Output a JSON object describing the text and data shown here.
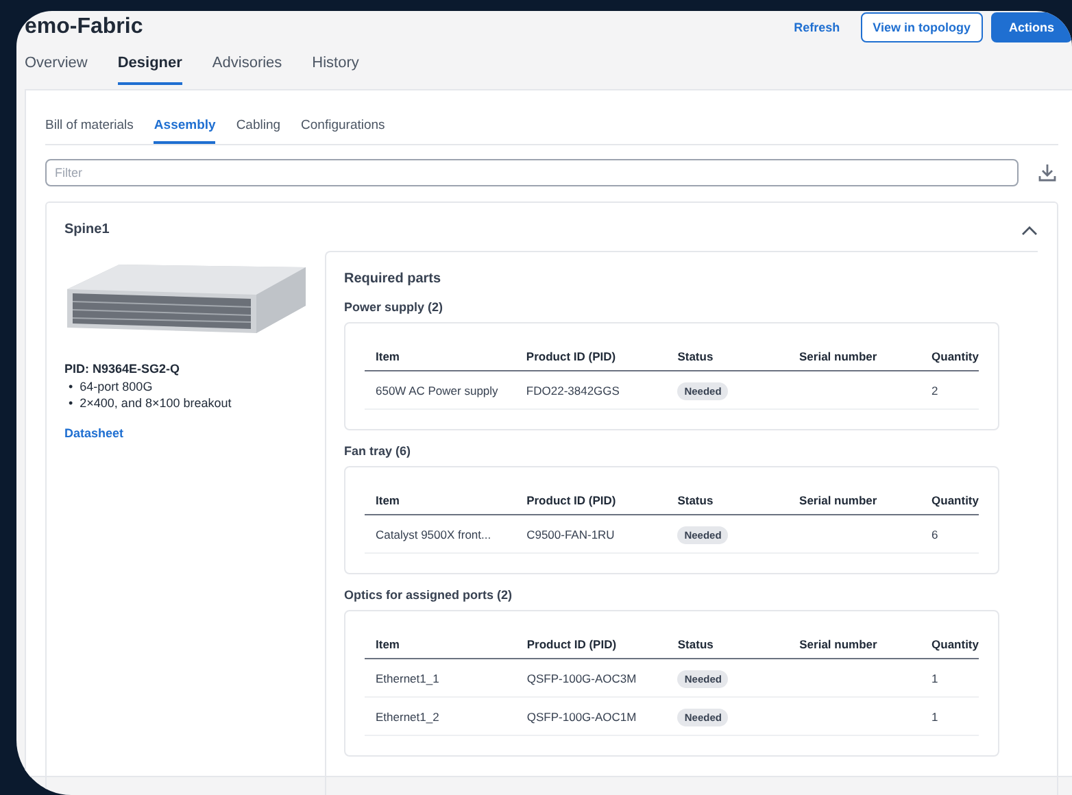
{
  "header": {
    "title": "emo-Fabric",
    "actions": [
      {
        "label": "Refresh",
        "kind": "link"
      },
      {
        "label": "View in topology",
        "kind": "outline"
      },
      {
        "label": "Actions",
        "kind": "primary"
      }
    ]
  },
  "tabs": [
    {
      "label": "Overview",
      "selected": false
    },
    {
      "label": "Designer",
      "selected": true
    },
    {
      "label": "Advisories",
      "selected": false
    },
    {
      "label": "History",
      "selected": false
    }
  ],
  "subtabs": [
    {
      "label": "Bill of materials",
      "selected": false
    },
    {
      "label": "Assembly",
      "selected": true
    },
    {
      "label": "Cabling",
      "selected": false
    },
    {
      "label": "Configurations",
      "selected": false
    }
  ],
  "filter": {
    "placeholder": "Filter"
  },
  "device": {
    "name": "Spine1",
    "expanded": true,
    "pid": "PID: N9364E-SG2-Q",
    "features": [
      {
        "bullet": "•",
        "text": "64-port 800G"
      },
      {
        "bullet": "•",
        "text": "2×400, and 8×100 breakout"
      }
    ],
    "link": "Datasheet"
  },
  "required_parts": {
    "title": "Required parts",
    "sections": [
      {
        "title": "Power supply (2)",
        "columns": [
          "Item",
          "Product ID (PID)",
          "Status",
          "Serial number",
          "Quantity"
        ],
        "rows": [
          {
            "item": "650W AC Power supply",
            "pid": "FDO22-3842GGS",
            "status": "Needed",
            "quantity": "2"
          }
        ]
      },
      {
        "title": "Fan tray (6)",
        "columns": [
          "Item",
          "Product ID (PID)",
          "Status",
          "Serial number",
          "Quantity"
        ],
        "rows": [
          {
            "item": "Catalyst 9500X front...",
            "pid": "C9500-FAN-1RU",
            "status": "Needed",
            "quantity": "6"
          }
        ]
      },
      {
        "title": "Optics for assigned ports (2)",
        "columns": [
          "Item",
          "Product ID (PID)",
          "Status",
          "Serial number",
          "Quantity"
        ],
        "rows": [
          {
            "item": "Ethernet1_1",
            "pid": "QSFP-100G-AOC3M",
            "status": "Needed",
            "quantity": "1"
          },
          {
            "item": "Ethernet1_2",
            "pid": "QSFP-100G-AOC1M",
            "status": "Needed",
            "quantity": "1"
          }
        ]
      }
    ]
  }
}
